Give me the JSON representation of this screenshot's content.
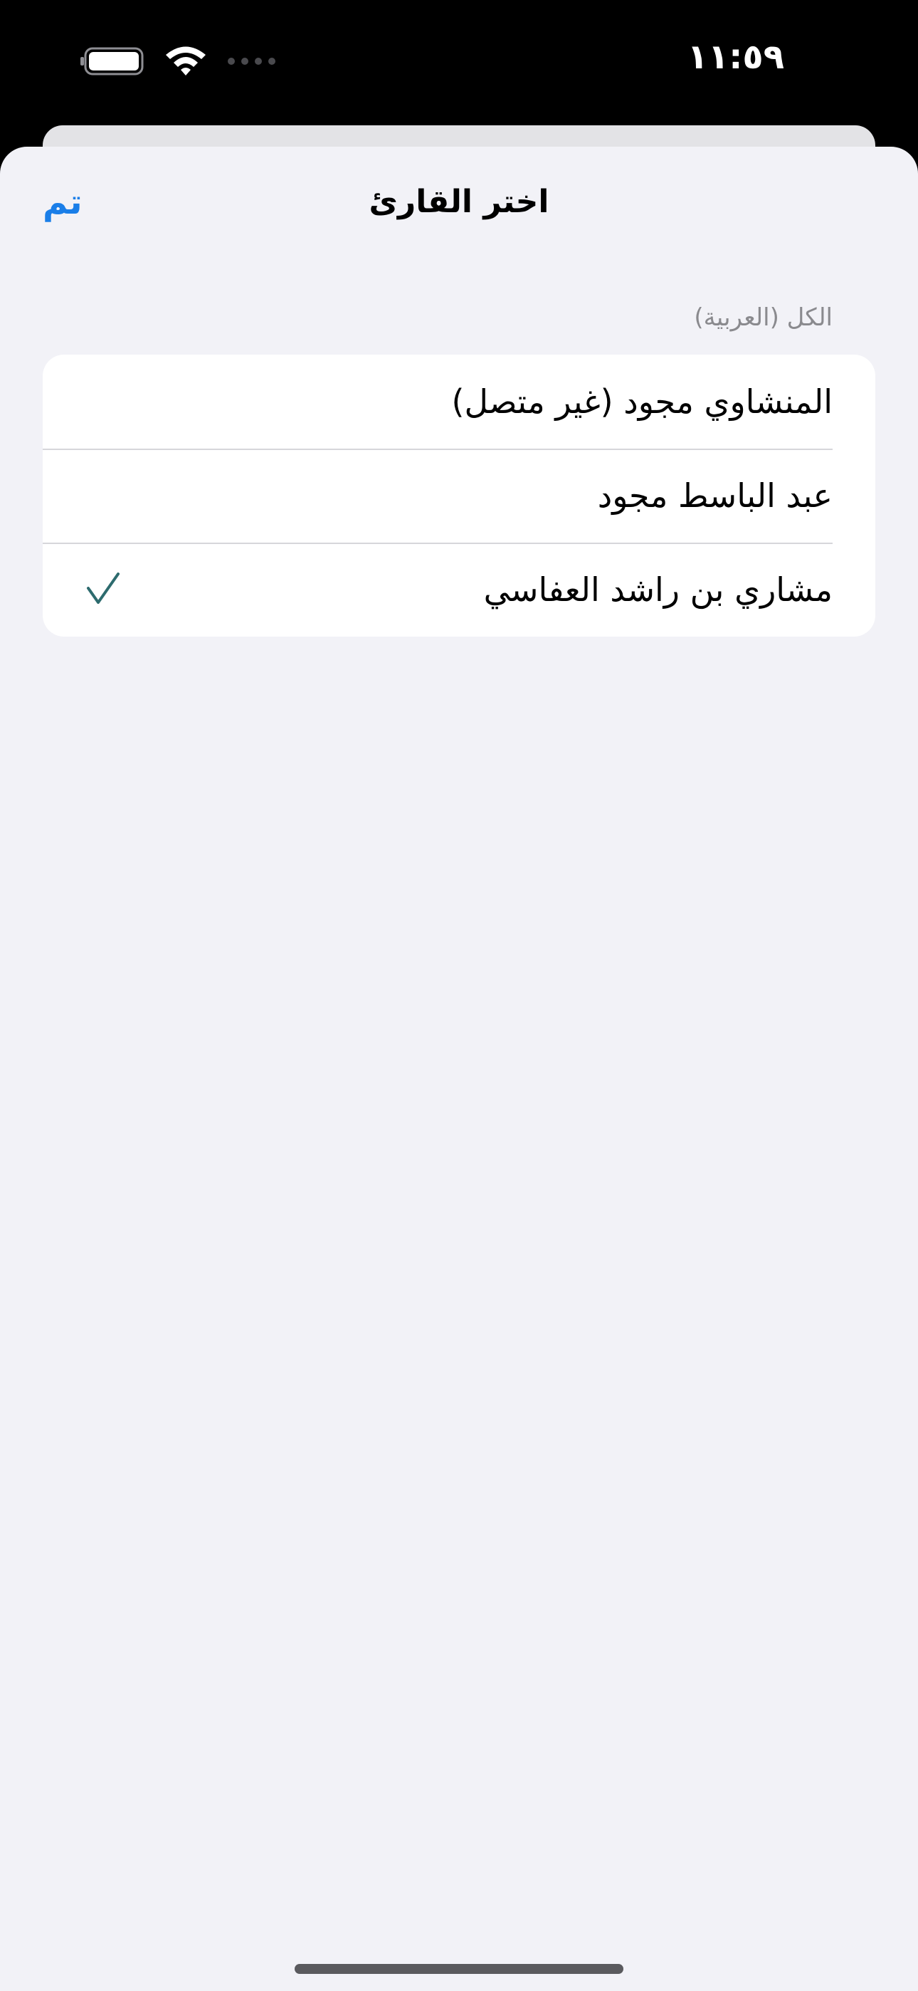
{
  "status_bar": {
    "time": "١١:٥٩",
    "icons": [
      "battery-icon",
      "wifi-icon",
      "signal-icon"
    ]
  },
  "nav": {
    "title": "اختر القارئ",
    "done_label": "تم"
  },
  "section": {
    "header": "الكل (العربية)"
  },
  "reciters": [
    {
      "label": "المنشاوي مجود (غير متصل)",
      "selected": false
    },
    {
      "label": "عبد الباسط مجود",
      "selected": false
    },
    {
      "label": "مشاري بن راشد العفاسي",
      "selected": true
    }
  ],
  "colors": {
    "accent": "#1a7ee8",
    "check": "#2d6b6e",
    "background": "#f2f2f7",
    "secondary_text": "#8a8a8e"
  }
}
